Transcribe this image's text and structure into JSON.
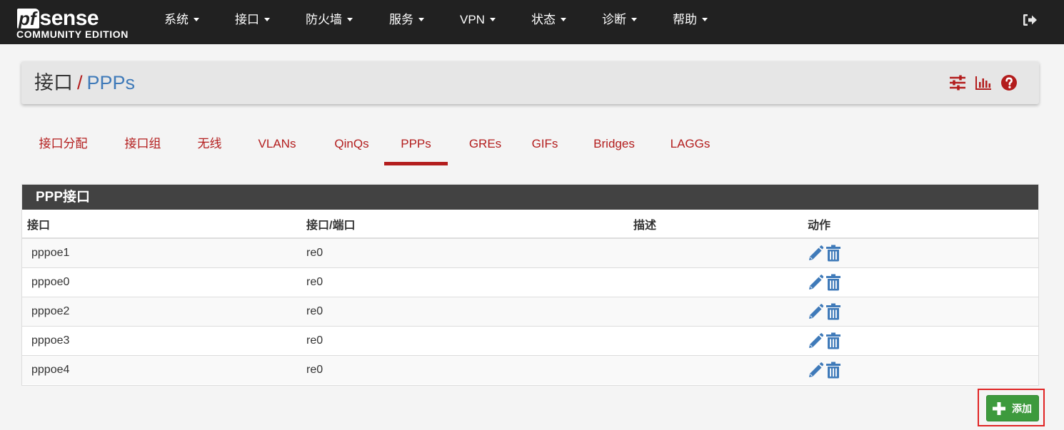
{
  "brand": {
    "logo_pf": "pf",
    "logo_sense": "sense",
    "edition": "COMMUNITY EDITION"
  },
  "nav": {
    "items": [
      {
        "label": "系统"
      },
      {
        "label": "接口"
      },
      {
        "label": "防火墙"
      },
      {
        "label": "服务"
      },
      {
        "label": "VPN"
      },
      {
        "label": "状态"
      },
      {
        "label": "诊断"
      },
      {
        "label": "帮助"
      }
    ],
    "logout_icon": "sign-out-icon"
  },
  "breadcrumb": {
    "root": "接口",
    "separator": "/",
    "current": "PPPs",
    "icons": [
      "sliders-icon",
      "bar-chart-icon",
      "help-icon"
    ]
  },
  "tabs": [
    {
      "label": "接口分配",
      "active": false
    },
    {
      "label": "接口组",
      "active": false
    },
    {
      "label": "无线",
      "active": false
    },
    {
      "label": "VLANs",
      "active": false
    },
    {
      "label": "QinQs",
      "active": false
    },
    {
      "label": "PPPs",
      "active": true
    },
    {
      "label": "GREs",
      "active": false
    },
    {
      "label": "GIFs",
      "active": false
    },
    {
      "label": "Bridges",
      "active": false
    },
    {
      "label": "LAGGs",
      "active": false
    }
  ],
  "panel": {
    "title": "PPP接口",
    "columns": [
      "接口",
      "接口/端口",
      "描述",
      "动作"
    ],
    "rows": [
      {
        "interface": "pppoe1",
        "port": "re0",
        "description": ""
      },
      {
        "interface": "pppoe0",
        "port": "re0",
        "description": ""
      },
      {
        "interface": "pppoe2",
        "port": "re0",
        "description": ""
      },
      {
        "interface": "pppoe3",
        "port": "re0",
        "description": ""
      },
      {
        "interface": "pppoe4",
        "port": "re0",
        "description": ""
      }
    ],
    "row_action_icons": [
      "pencil-icon",
      "trash-icon"
    ]
  },
  "add_button": {
    "label": "添加",
    "icon": "plus-icon"
  },
  "colors": {
    "navbar_bg": "#212121",
    "accent_red": "#b31d1d",
    "link_blue": "#3f7ab9",
    "action_blue": "#3f7ab9",
    "panel_heading": "#424242",
    "success_green": "#3d9a3d",
    "highlight_border": "#e02424"
  }
}
